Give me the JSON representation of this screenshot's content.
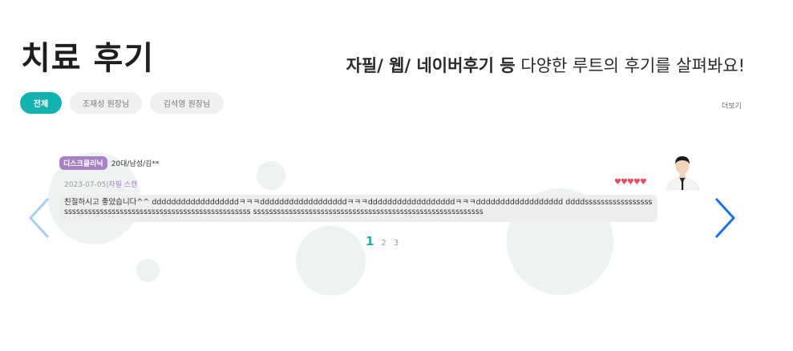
{
  "header": {
    "title": "치료 후기",
    "subtitle_strong": "자필/ 웹/ 네이버후기 등",
    "subtitle_rest": " 다양한 루트의 후기를 살펴봐요!"
  },
  "tabs": [
    {
      "label": "전체",
      "active": true
    },
    {
      "label": "조재성 원장님",
      "active": false
    },
    {
      "label": "김석영 원장님",
      "active": false
    }
  ],
  "more_label": "더보기",
  "review": {
    "badge": "디스크클리닉",
    "author": "20대/남성/김**",
    "date": "2023-07-05",
    "separator": "|",
    "source": "자필 스캔",
    "stars": "♥♥♥♥♥",
    "rating": 5,
    "text": "친절하시고 좋았습니다^^ ddddddddddddddddddㅋㅋㅋddddddddddddddddddㅋㅋㅋddddddddddddddddddㅋㅋㅋdddddddddddddddddd ddddssssssssssssssssssssssssssssssssssssssssssssssssssssssssssssssss ssssssssssssssssssssssssssssssssssssssssssssssssssssssssss"
  },
  "pagination": {
    "pages": [
      "1",
      "2",
      "3"
    ],
    "current": "1"
  },
  "colors": {
    "accent": "#11b2b0",
    "badge": "#a682c4",
    "heart": "#e84a5f",
    "arrow_left": "#a8cff0",
    "arrow_right": "#1a73e8"
  }
}
